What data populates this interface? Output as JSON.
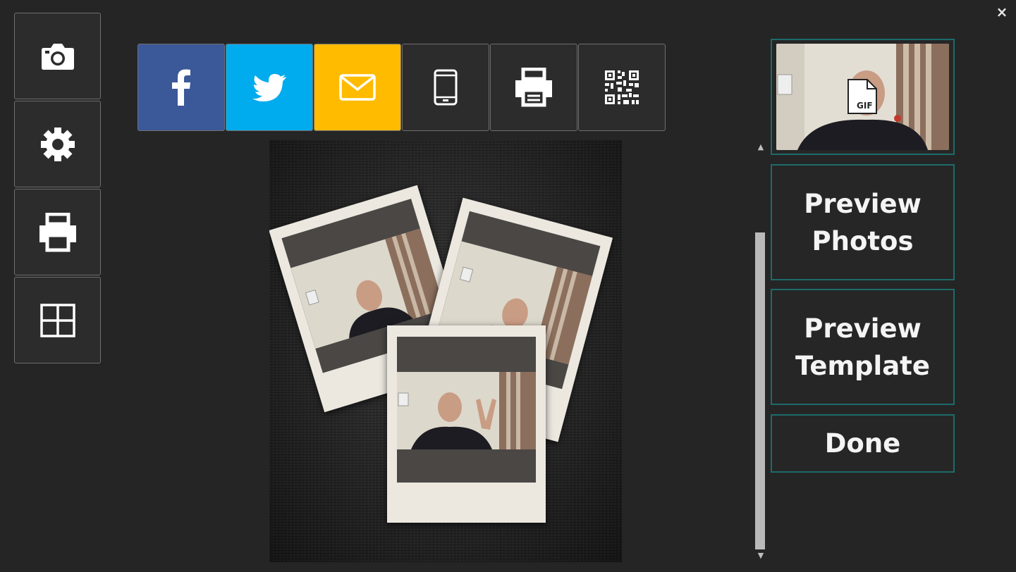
{
  "window": {
    "close_glyph": "×"
  },
  "left_toolbar": {
    "items": [
      {
        "name": "camera",
        "icon": "camera-icon"
      },
      {
        "name": "settings",
        "icon": "gear-icon"
      },
      {
        "name": "print",
        "icon": "printer-icon"
      },
      {
        "name": "layout",
        "icon": "grid-icon"
      }
    ]
  },
  "share_bar": {
    "items": [
      {
        "name": "facebook",
        "icon": "facebook-icon",
        "color": "#3b5898"
      },
      {
        "name": "twitter",
        "icon": "twitter-icon",
        "color": "#00aced"
      },
      {
        "name": "email",
        "icon": "mail-icon",
        "color": "#ffbb00"
      },
      {
        "name": "sms",
        "icon": "phone-icon",
        "color": "#2c2c2c"
      },
      {
        "name": "print",
        "icon": "printer-icon",
        "color": "#2c2c2c"
      },
      {
        "name": "qr",
        "icon": "qr-code-icon",
        "color": "#2c2c2c"
      }
    ]
  },
  "preview": {
    "thumbnail_badge": "GIF",
    "buttons": {
      "preview_photos_line1": "Preview",
      "preview_photos_line2": "Photos",
      "preview_template_line1": "Preview",
      "preview_template_line2": "Template",
      "done": "Done"
    }
  },
  "scrollbar": {
    "up_glyph": "▲",
    "down_glyph": "▼"
  },
  "colors": {
    "accent_border": "#1d6b6b",
    "background": "#252525"
  }
}
